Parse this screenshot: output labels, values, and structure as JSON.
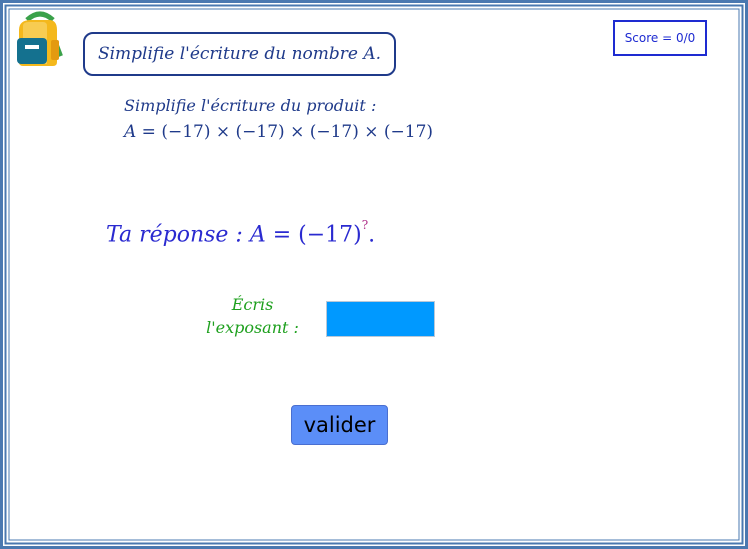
{
  "exercise": {
    "title": "Simplifie l'écriture du nombre A.",
    "score": "Score = 0/0",
    "instruction": "Simplifie l'écriture du produit :",
    "expression": {
      "variable": "A",
      "equals": " = ",
      "body": "(−17) × (−17) × (−17) × (−17)"
    },
    "answer": {
      "label": "Ta réponse : ",
      "variable": "A",
      "equals": " = ",
      "base": "(−17)",
      "exponent_placeholder": "?",
      "end": "."
    },
    "exponent_field": {
      "label_line1": "Écris",
      "label_line2": "l'exposant :",
      "value": ""
    },
    "validate_label": "valider"
  },
  "colors": {
    "frame_blue": "#4a78b0",
    "text_blue": "#1f3a8a",
    "answer_blue": "#2a2ad0",
    "green": "#1ea01e",
    "input_blue": "#0099ff",
    "button_blue": "#5b8ef8"
  },
  "icons": {
    "logo": "backpack-icon"
  }
}
